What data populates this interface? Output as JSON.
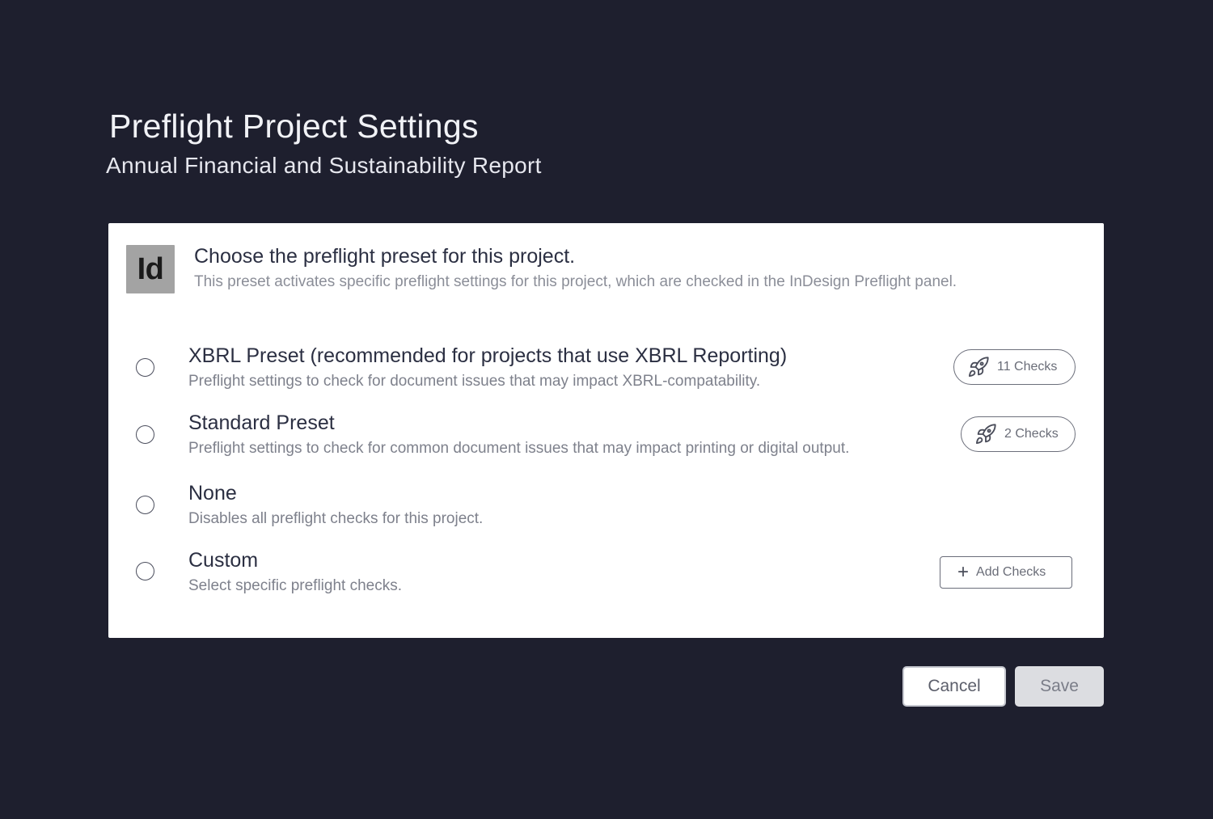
{
  "header": {
    "title": "Preflight Project Settings",
    "subtitle": "Annual Financial and Sustainability Report"
  },
  "panel": {
    "app_icon_text": "Id",
    "heading": "Choose the preflight preset for this project.",
    "description": "This preset activates specific preflight settings for this project, which are checked in the InDesign Preflight panel."
  },
  "options": [
    {
      "title": "XBRL Preset (recommended for projects that use XBRL Reporting)",
      "description": "Preflight settings to check for document issues that may impact XBRL-compatability.",
      "selected": false,
      "badge": "11 Checks",
      "badge_icon": "rocket-icon"
    },
    {
      "title": "Standard Preset",
      "description": "Preflight settings to check for common document issues that may impact printing or digital output.",
      "selected": false,
      "badge": "2 Checks",
      "badge_icon": "rocket-icon"
    },
    {
      "title": "None",
      "description": "Disables all preflight checks for this project.",
      "selected": false
    },
    {
      "title": "Custom",
      "description": "Select specific preflight checks.",
      "selected": false,
      "action_label": "Add Checks",
      "action_icon": "plus-icon"
    }
  ],
  "footer": {
    "cancel_label": "Cancel",
    "save_label": "Save"
  },
  "colors": {
    "background": "#1e1f2e",
    "panel": "#ffffff",
    "app_icon_bg": "#a3a3a3",
    "save_disabled_bg": "#dcdde1"
  }
}
